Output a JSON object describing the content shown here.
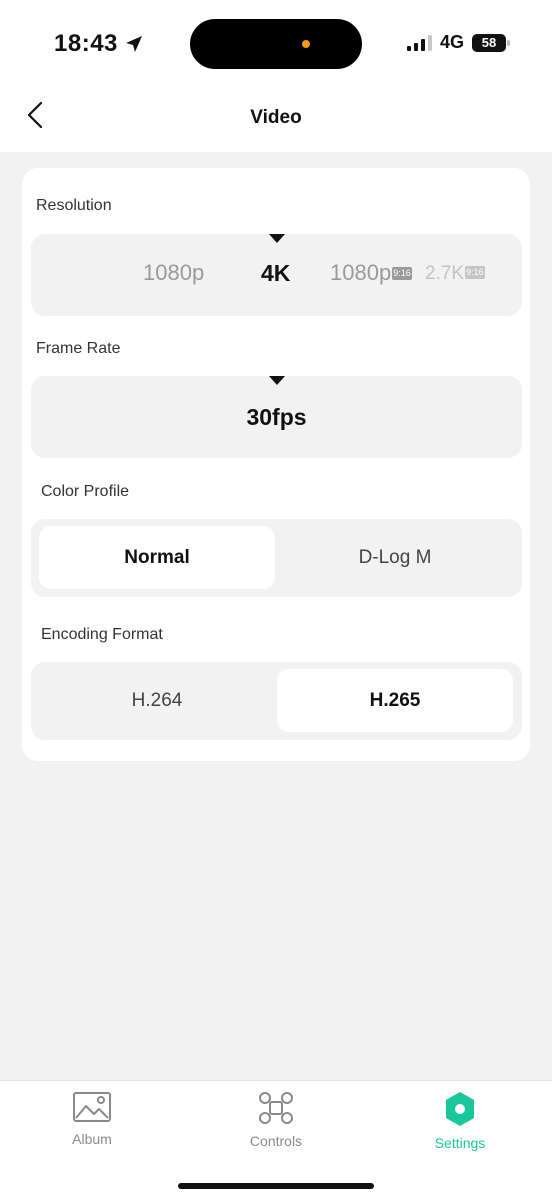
{
  "status": {
    "time": "18:43",
    "network": "4G",
    "battery": "58"
  },
  "header": {
    "title": "Video"
  },
  "resolution": {
    "label": "Resolution",
    "options": [
      "1080p",
      "4K",
      "1080p",
      "2.7K"
    ],
    "tags": [
      "9:16",
      "9:16"
    ],
    "selected": "4K"
  },
  "frame_rate": {
    "label": "Frame Rate",
    "value": "30fps"
  },
  "color_profile": {
    "label": "Color Profile",
    "options": [
      "Normal",
      "D-Log M"
    ],
    "selected": "Normal"
  },
  "encoding": {
    "label": "Encoding Format",
    "options": [
      "H.264",
      "H.265"
    ],
    "selected": "H.265"
  },
  "tabs": [
    {
      "label": "Album",
      "icon": "album-icon"
    },
    {
      "label": "Controls",
      "icon": "controls-icon"
    },
    {
      "label": "Settings",
      "icon": "settings-icon"
    }
  ],
  "colors": {
    "accent": "#19c79a",
    "background": "#f2f2f2"
  }
}
